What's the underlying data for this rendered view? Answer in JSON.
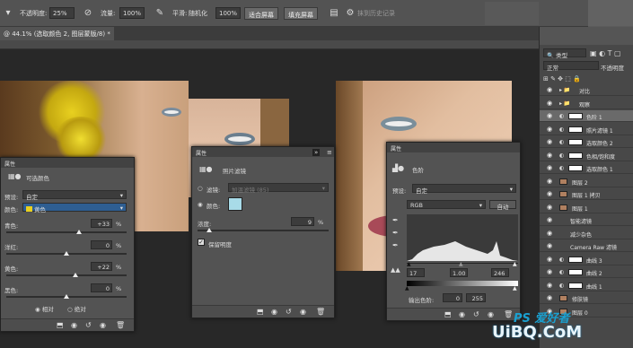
{
  "optbar": {
    "opacity_label": "不透明度:",
    "opacity_value": "25%",
    "flow_label": "流量:",
    "flow_value": "100%",
    "smoothing_label": "平滑:",
    "smoothing_value": "随机化",
    "percent_value": "100%",
    "fit_button": "适合屏幕",
    "fill_button": "填充屏幕",
    "history_label": "抹到历史记录"
  },
  "doc_tab": "@ 44.1% (选取颜色 2, 图层蒙版/8) *",
  "layers_panel": {
    "kind_label": "类型",
    "mode_label": "正常",
    "opacity_label": "不透明度",
    "layers": [
      {
        "name": "对比",
        "type": "group"
      },
      {
        "name": "观察",
        "type": "group"
      },
      {
        "name": "色阶 1",
        "type": "adj",
        "selected": true
      },
      {
        "name": "照片滤镜 1",
        "type": "adj"
      },
      {
        "name": "选取颜色 2",
        "type": "adj"
      },
      {
        "name": "色相/饱和度",
        "type": "adj"
      },
      {
        "name": "选取颜色 1",
        "type": "adj"
      },
      {
        "name": "图层 2",
        "type": "pixel"
      },
      {
        "name": "图层 1 拷贝",
        "type": "pixel"
      },
      {
        "name": "图层 1",
        "type": "smart"
      },
      {
        "name": "智能滤镜",
        "type": "filter"
      },
      {
        "name": "减少杂色",
        "type": "filter"
      },
      {
        "name": "Camera Raw 滤镜",
        "type": "filter"
      },
      {
        "name": "曲线 3",
        "type": "adj"
      },
      {
        "name": "曲线 2",
        "type": "adj"
      },
      {
        "name": "曲线 1",
        "type": "adj"
      },
      {
        "name": "修肤镜",
        "type": "pixel"
      },
      {
        "name": "图层 0",
        "type": "pixel"
      }
    ]
  },
  "panel_selective": {
    "tab": "属性",
    "title": "可选颜色",
    "preset_label": "预设:",
    "preset_value": "自定",
    "colors_label": "颜色:",
    "colors_value": "黄色",
    "sliders": [
      {
        "label": "青色:",
        "value": "+33",
        "unit": "%",
        "pos": 0.6
      },
      {
        "label": "洋红:",
        "value": "0",
        "unit": "%",
        "pos": 0.5
      },
      {
        "label": "黄色:",
        "value": "+22",
        "unit": "%",
        "pos": 0.57
      },
      {
        "label": "黑色:",
        "value": "0",
        "unit": "%",
        "pos": 0.5
      }
    ],
    "radio_relative": "相对",
    "radio_absolute": "绝对"
  },
  "panel_photo_filter": {
    "tab": "属性",
    "title": "照片滤镜",
    "filter_label": "滤镜:",
    "filter_value": "加温滤镜 (85)",
    "color_label": "颜色:",
    "color_swatch": "#a8dbe8",
    "density_label": "浓度:",
    "density_value": "9",
    "density_unit": "%",
    "density_pos": 0.09,
    "preserve_label": "保留明度"
  },
  "panel_levels": {
    "tab": "属性",
    "title": "色阶",
    "preset_label": "预设:",
    "preset_value": "自定",
    "channel_value": "RGB",
    "auto_button": "自动",
    "input_black": "17",
    "input_gamma": "1.00",
    "input_white": "246",
    "output_label": "输出色阶:",
    "output_black": "0",
    "output_white": "255"
  },
  "watermark": {
    "line1": "PS 爱好者",
    "line2": "UiBQ.CoM"
  }
}
